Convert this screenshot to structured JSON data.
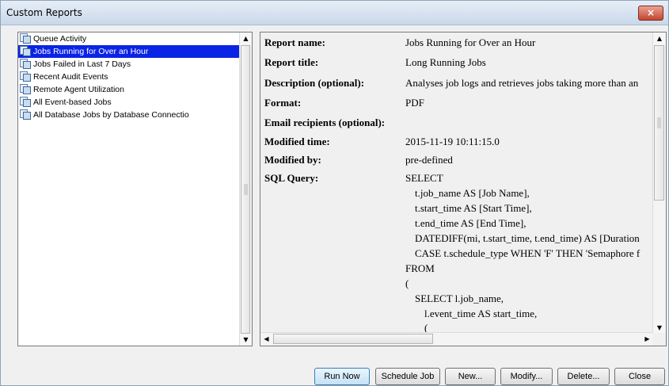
{
  "window": {
    "title": "Custom Reports",
    "close_label": "×"
  },
  "reports": [
    {
      "label": "Queue Activity",
      "selected": false
    },
    {
      "label": "Jobs Running for Over an Hour",
      "selected": true
    },
    {
      "label": "Jobs Failed in Last 7 Days",
      "selected": false
    },
    {
      "label": "Recent Audit Events",
      "selected": false
    },
    {
      "label": "Remote Agent Utilization",
      "selected": false
    },
    {
      "label": "All Event-based Jobs",
      "selected": false
    },
    {
      "label": "All Database Jobs by Database Connectio",
      "selected": false
    }
  ],
  "details": {
    "report_name_label": "Report name:",
    "report_name": "Jobs Running for Over an Hour",
    "report_title_label": "Report title:",
    "report_title": "Long Running Jobs",
    "description_label": "Description (optional):",
    "description": "Analyses job logs and retrieves jobs taking more than an",
    "format_label": "Format:",
    "format": "PDF",
    "email_label": "Email recipients (optional):",
    "email": "",
    "modified_time_label": "Modified time:",
    "modified_time": "2015-11-19 10:11:15.0",
    "modified_by_label": "Modified by:",
    "modified_by": "pre-defined",
    "sql_label": "SQL Query:",
    "sql_lines": [
      "SELECT",
      "t.job_name AS [Job Name],",
      "t.start_time AS [Start Time],",
      "t.end_time AS [End Time],",
      "DATEDIFF(mi, t.start_time, t.end_time) AS [Duration",
      "CASE t.schedule_type WHEN 'F' THEN 'Semaphore f",
      "FROM",
      "(",
      "SELECT l.job_name,",
      "l.event_time AS start_time,",
      "("
    ]
  },
  "buttons": {
    "run_now": "Run Now",
    "schedule_job": "Schedule Job",
    "new": "New...",
    "modify": "Modify...",
    "delete": "Delete...",
    "close": "Close"
  },
  "scroll_arrows": {
    "up": "▲",
    "down": "▼",
    "left": "◀",
    "right": "▶"
  }
}
